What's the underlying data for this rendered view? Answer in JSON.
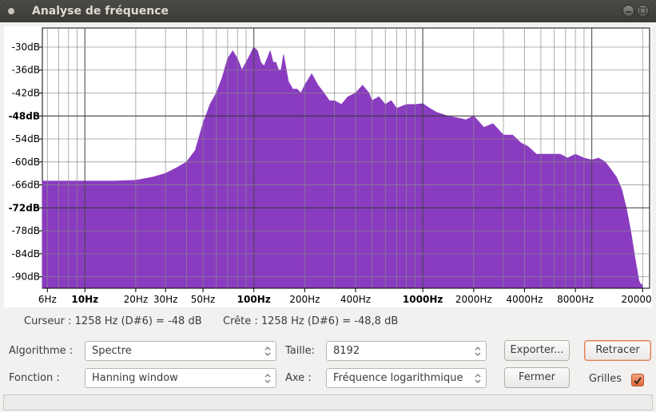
{
  "window": {
    "title": "Analyse de fréquence"
  },
  "chart_data": {
    "type": "area",
    "title": "",
    "xscale": "log",
    "grid": true,
    "fill_color": "#8a3cc0",
    "x_ticks": [
      "6Hz",
      "10Hz",
      "20Hz",
      "30Hz",
      "50Hz",
      "100Hz",
      "200Hz",
      "400Hz",
      "1000Hz",
      "2000Hz",
      "4000Hz",
      "8000Hz",
      "20000Hz"
    ],
    "bold_x_ticks": [
      "10Hz",
      "100Hz",
      "1000Hz"
    ],
    "y_ticks": [
      "-30dB",
      "-36dB",
      "-42dB",
      "-48dB",
      "-54dB",
      "-60dB",
      "-66dB",
      "-72dB",
      "-78dB",
      "-84dB",
      "-90dB"
    ],
    "bold_y_ticks": [
      "-48dB",
      "-72dB"
    ],
    "ylim": [
      -93,
      -25
    ],
    "xlim": [
      5.6,
      22000
    ],
    "x": [
      5.6,
      8,
      10,
      15,
      20,
      25,
      30,
      35,
      40,
      45,
      50,
      55,
      60,
      65,
      70,
      75,
      80,
      85,
      90,
      95,
      100,
      105,
      110,
      115,
      120,
      125,
      130,
      135,
      140,
      145,
      150,
      160,
      170,
      180,
      190,
      200,
      220,
      240,
      260,
      280,
      300,
      330,
      360,
      400,
      440,
      480,
      500,
      550,
      600,
      650,
      700,
      800,
      900,
      1000,
      1100,
      1200,
      1400,
      1600,
      1800,
      2000,
      2300,
      2600,
      3000,
      3400,
      3800,
      4200,
      4700,
      5200,
      5800,
      6500,
      7200,
      8000,
      9000,
      10000,
      11000,
      12000,
      13000,
      14000,
      15000,
      16000,
      17000,
      18000,
      18500,
      19000,
      19500,
      20000
    ],
    "y": [
      -65,
      -65,
      -65,
      -65,
      -64.8,
      -64,
      -63,
      -61.5,
      -60,
      -57,
      -50,
      -45,
      -42,
      -38,
      -33,
      -31,
      -33,
      -36,
      -34,
      -32,
      -30,
      -31,
      -34,
      -35,
      -33,
      -31,
      -34,
      -34,
      -36,
      -36,
      -32,
      -39,
      -41,
      -41,
      -42,
      -40,
      -37,
      -40,
      -42,
      -44,
      -44,
      -45,
      -43,
      -42,
      -40,
      -42,
      -44,
      -43,
      -45,
      -44,
      -46,
      -45,
      -45,
      -44.8,
      -46,
      -47,
      -48,
      -48.5,
      -49,
      -48,
      -51,
      -50,
      -53,
      -53,
      -55,
      -56,
      -58,
      -58,
      -58,
      -58,
      -59,
      -58,
      -59,
      -59.5,
      -59,
      -60,
      -62,
      -64,
      -67,
      -72,
      -78,
      -85,
      -88,
      -91,
      -92,
      -92
    ]
  },
  "status": {
    "cursor": "Curseur : 1258 Hz (D#6) = -48 dB",
    "peak": "Crête : 1258 Hz (D#6) = -48,8 dB"
  },
  "controls": {
    "algorithm_label": "Algorithme :",
    "algorithm_value": "Spectre",
    "size_label": "Taille:",
    "size_value": "8192",
    "function_label": "Fonction :",
    "function_value": "Hanning window",
    "axis_label": "Axe :",
    "axis_value": "Fréquence logarithmique",
    "export_button": "Exporter...",
    "replot_button": "Retracer",
    "close_button": "Fermer",
    "grids_label": "Grilles",
    "grids_checked": true
  }
}
